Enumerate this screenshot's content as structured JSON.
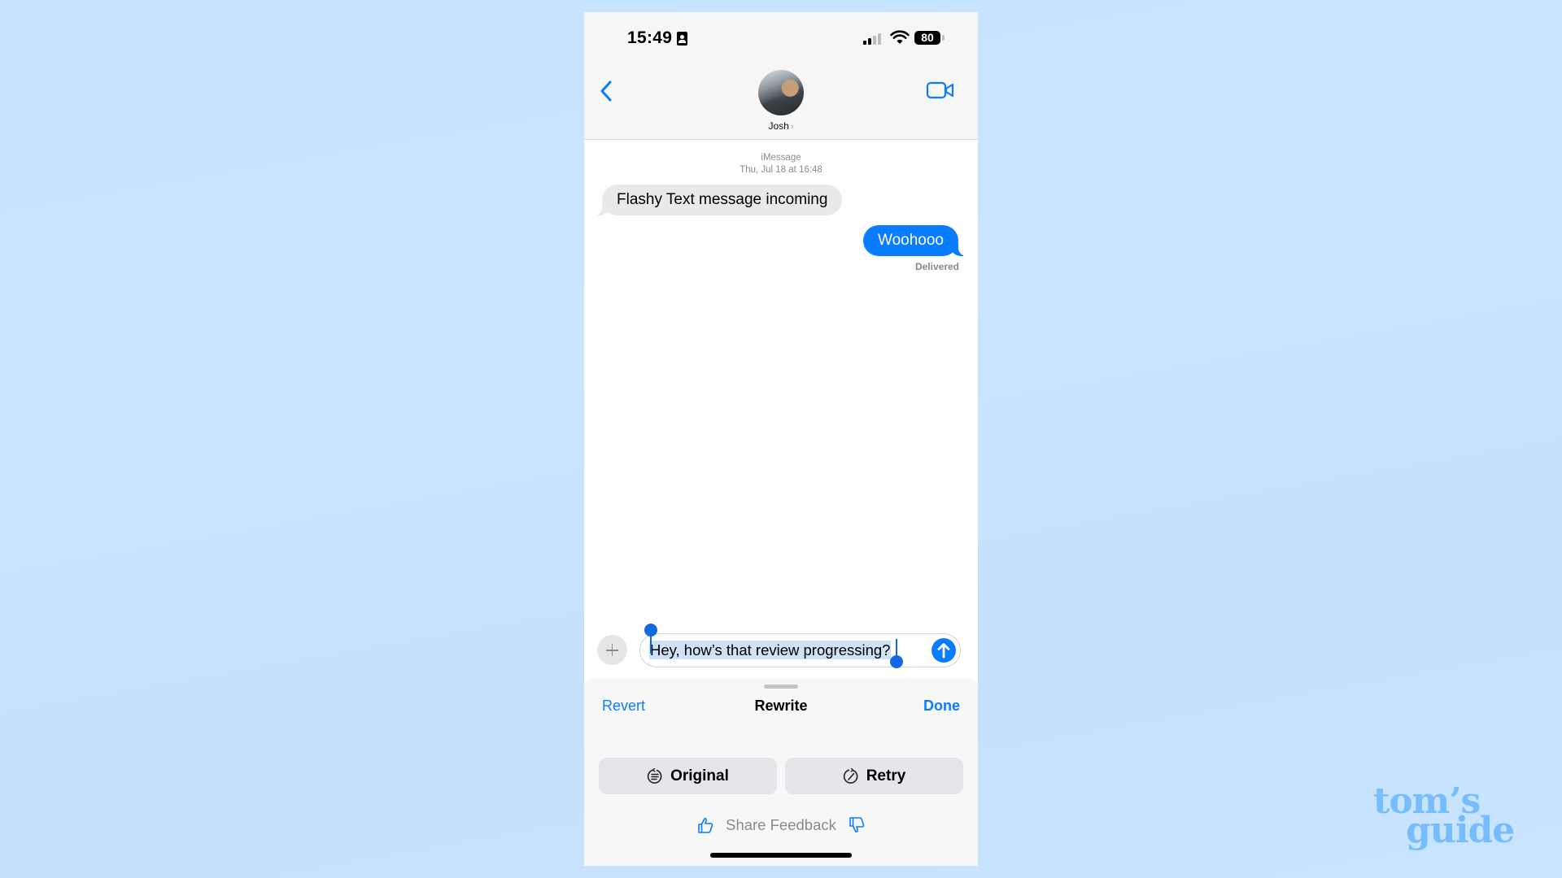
{
  "status_bar": {
    "time": "15:49",
    "battery_percent": "80",
    "signal_bars_active": 2,
    "signal_bars_total": 4,
    "icons": [
      "contact-card-icon",
      "signal-icon",
      "wifi-icon",
      "battery-icon"
    ]
  },
  "header": {
    "back_icon": "chevron-left-icon",
    "contact_name": "Josh",
    "contact_chevron": "›",
    "video_icon": "video-camera-icon"
  },
  "thread": {
    "service": "iMessage",
    "date": "Thu, Jul 18 at 16:48",
    "messages": [
      {
        "direction": "incoming",
        "text": "Flashy Text message incoming"
      },
      {
        "direction": "outgoing",
        "text": "Woohooo",
        "status": "Delivered"
      }
    ]
  },
  "composer": {
    "plus_icon": "plus-icon",
    "value": "Hey, how’s that review progressing?",
    "selected": true,
    "send_icon": "arrow-up-icon"
  },
  "rewrite_sheet": {
    "revert_label": "Revert",
    "title": "Rewrite",
    "done_label": "Done",
    "buttons": [
      {
        "label": "Original",
        "icon": "original-text-icon"
      },
      {
        "label": "Retry",
        "icon": "retry-icon"
      }
    ],
    "feedback_label": "Share Feedback",
    "thumbs_up_icon": "thumbs-up-icon",
    "thumbs_down_icon": "thumbs-down-icon"
  },
  "watermark": {
    "line1": "tom’s",
    "line2": "guide"
  },
  "colors": {
    "accent": "#0a7cff",
    "incoming_bubble": "#e9e9eb",
    "background": "#c6e2ff",
    "watermark": "#77bdfd"
  }
}
